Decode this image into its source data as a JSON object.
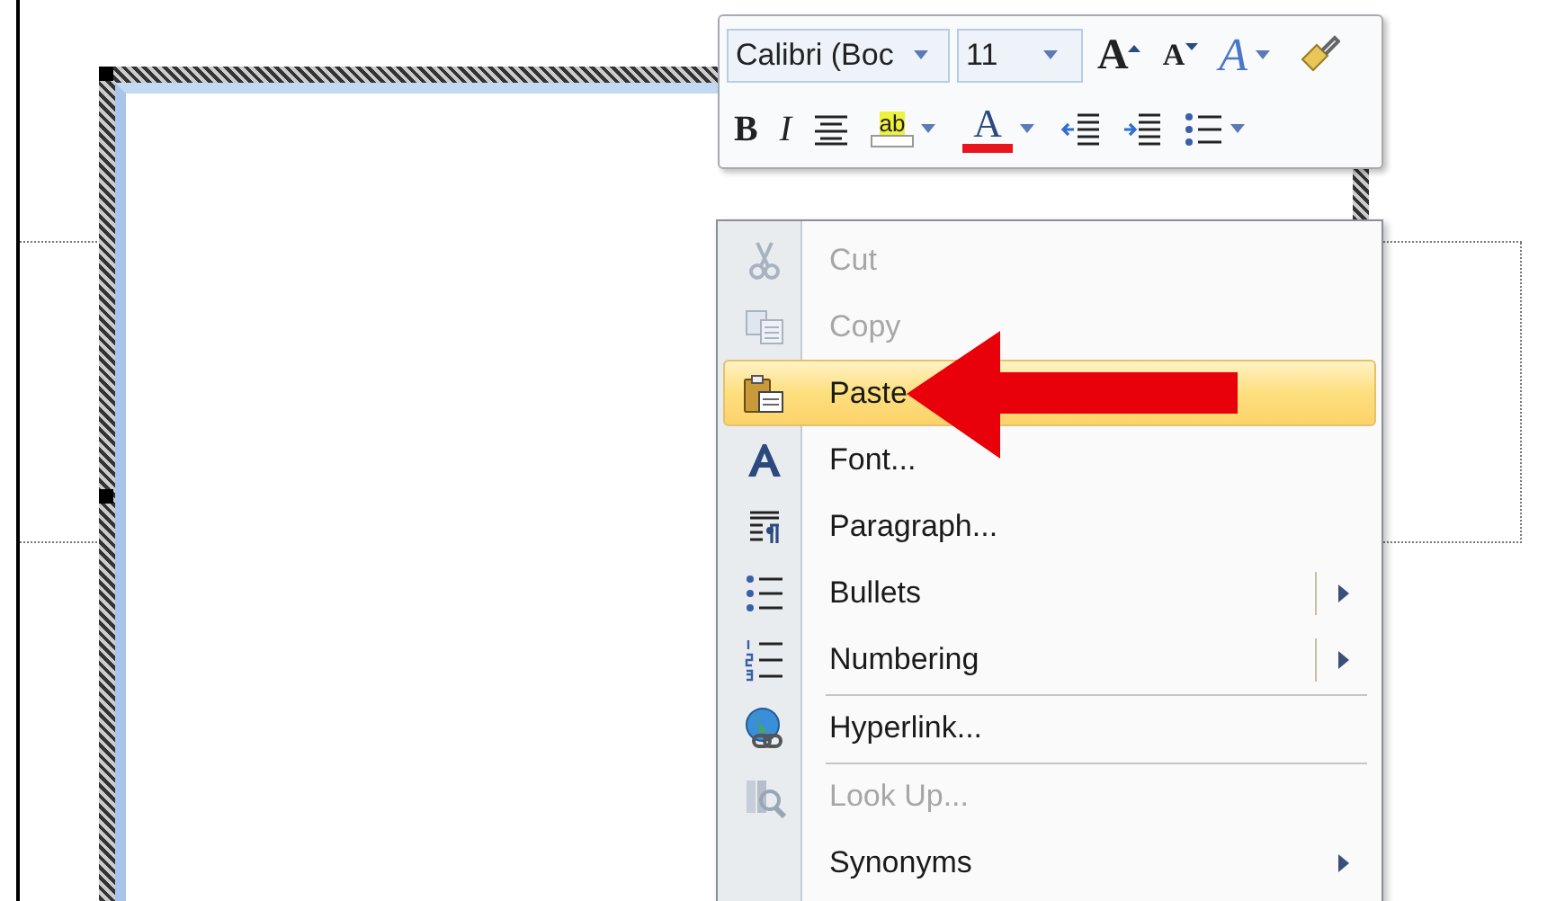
{
  "mini_toolbar": {
    "font": {
      "value": "Calibri (Boc"
    },
    "size": {
      "value": "11"
    },
    "row_1": [
      {
        "kind": "grow",
        "glyph": "A",
        "dropdown": false
      },
      {
        "kind": "shrink",
        "glyph": "A",
        "dropdown": false
      },
      {
        "kind": "styles",
        "glyph": "A",
        "dropdown": true
      },
      {
        "kind": "painter",
        "dropdown": false
      }
    ],
    "row_2": [
      {
        "kind": "bold",
        "glyph": "B",
        "dropdown": false
      },
      {
        "kind": "italic",
        "glyph": "I",
        "dropdown": false
      },
      {
        "kind": "center",
        "dropdown": false
      },
      {
        "kind": "highlight",
        "glyph": "ab",
        "dropdown": true
      },
      {
        "kind": "fontcolor",
        "glyph": "A",
        "dropdown": true
      },
      {
        "kind": "outdent",
        "dropdown": false
      },
      {
        "kind": "indent",
        "dropdown": false
      },
      {
        "kind": "bullets",
        "dropdown": true
      }
    ]
  },
  "context_menu": {
    "items": [
      {
        "kind": "cut",
        "label": "Cut",
        "disabled": true,
        "selected": false,
        "separator_before": false,
        "submenu": false,
        "split": false
      },
      {
        "kind": "copy",
        "label": "Copy",
        "disabled": true,
        "selected": false,
        "separator_before": false,
        "submenu": false,
        "split": false
      },
      {
        "kind": "paste",
        "label": "Paste",
        "disabled": false,
        "selected": true,
        "separator_before": false,
        "submenu": false,
        "split": false
      },
      {
        "kind": "font",
        "label": "Font...",
        "disabled": false,
        "selected": false,
        "separator_before": false,
        "submenu": false,
        "split": false
      },
      {
        "kind": "paragraph",
        "label": "Paragraph...",
        "disabled": false,
        "selected": false,
        "separator_before": false,
        "submenu": false,
        "split": false
      },
      {
        "kind": "bullets",
        "label": "Bullets",
        "disabled": false,
        "selected": false,
        "separator_before": false,
        "submenu": true,
        "split": true
      },
      {
        "kind": "numbering",
        "label": "Numbering",
        "disabled": false,
        "selected": false,
        "separator_before": false,
        "submenu": true,
        "split": true
      },
      {
        "kind": "hyperlink",
        "label": "Hyperlink...",
        "disabled": false,
        "selected": false,
        "separator_before": true,
        "submenu": false,
        "split": false
      },
      {
        "kind": "lookup",
        "label": "Look Up...",
        "disabled": true,
        "selected": false,
        "separator_before": true,
        "submenu": false,
        "split": false
      },
      {
        "kind": "synonyms",
        "label": "Synonyms",
        "disabled": false,
        "selected": false,
        "separator_before": false,
        "submenu": true,
        "split": false
      }
    ]
  }
}
